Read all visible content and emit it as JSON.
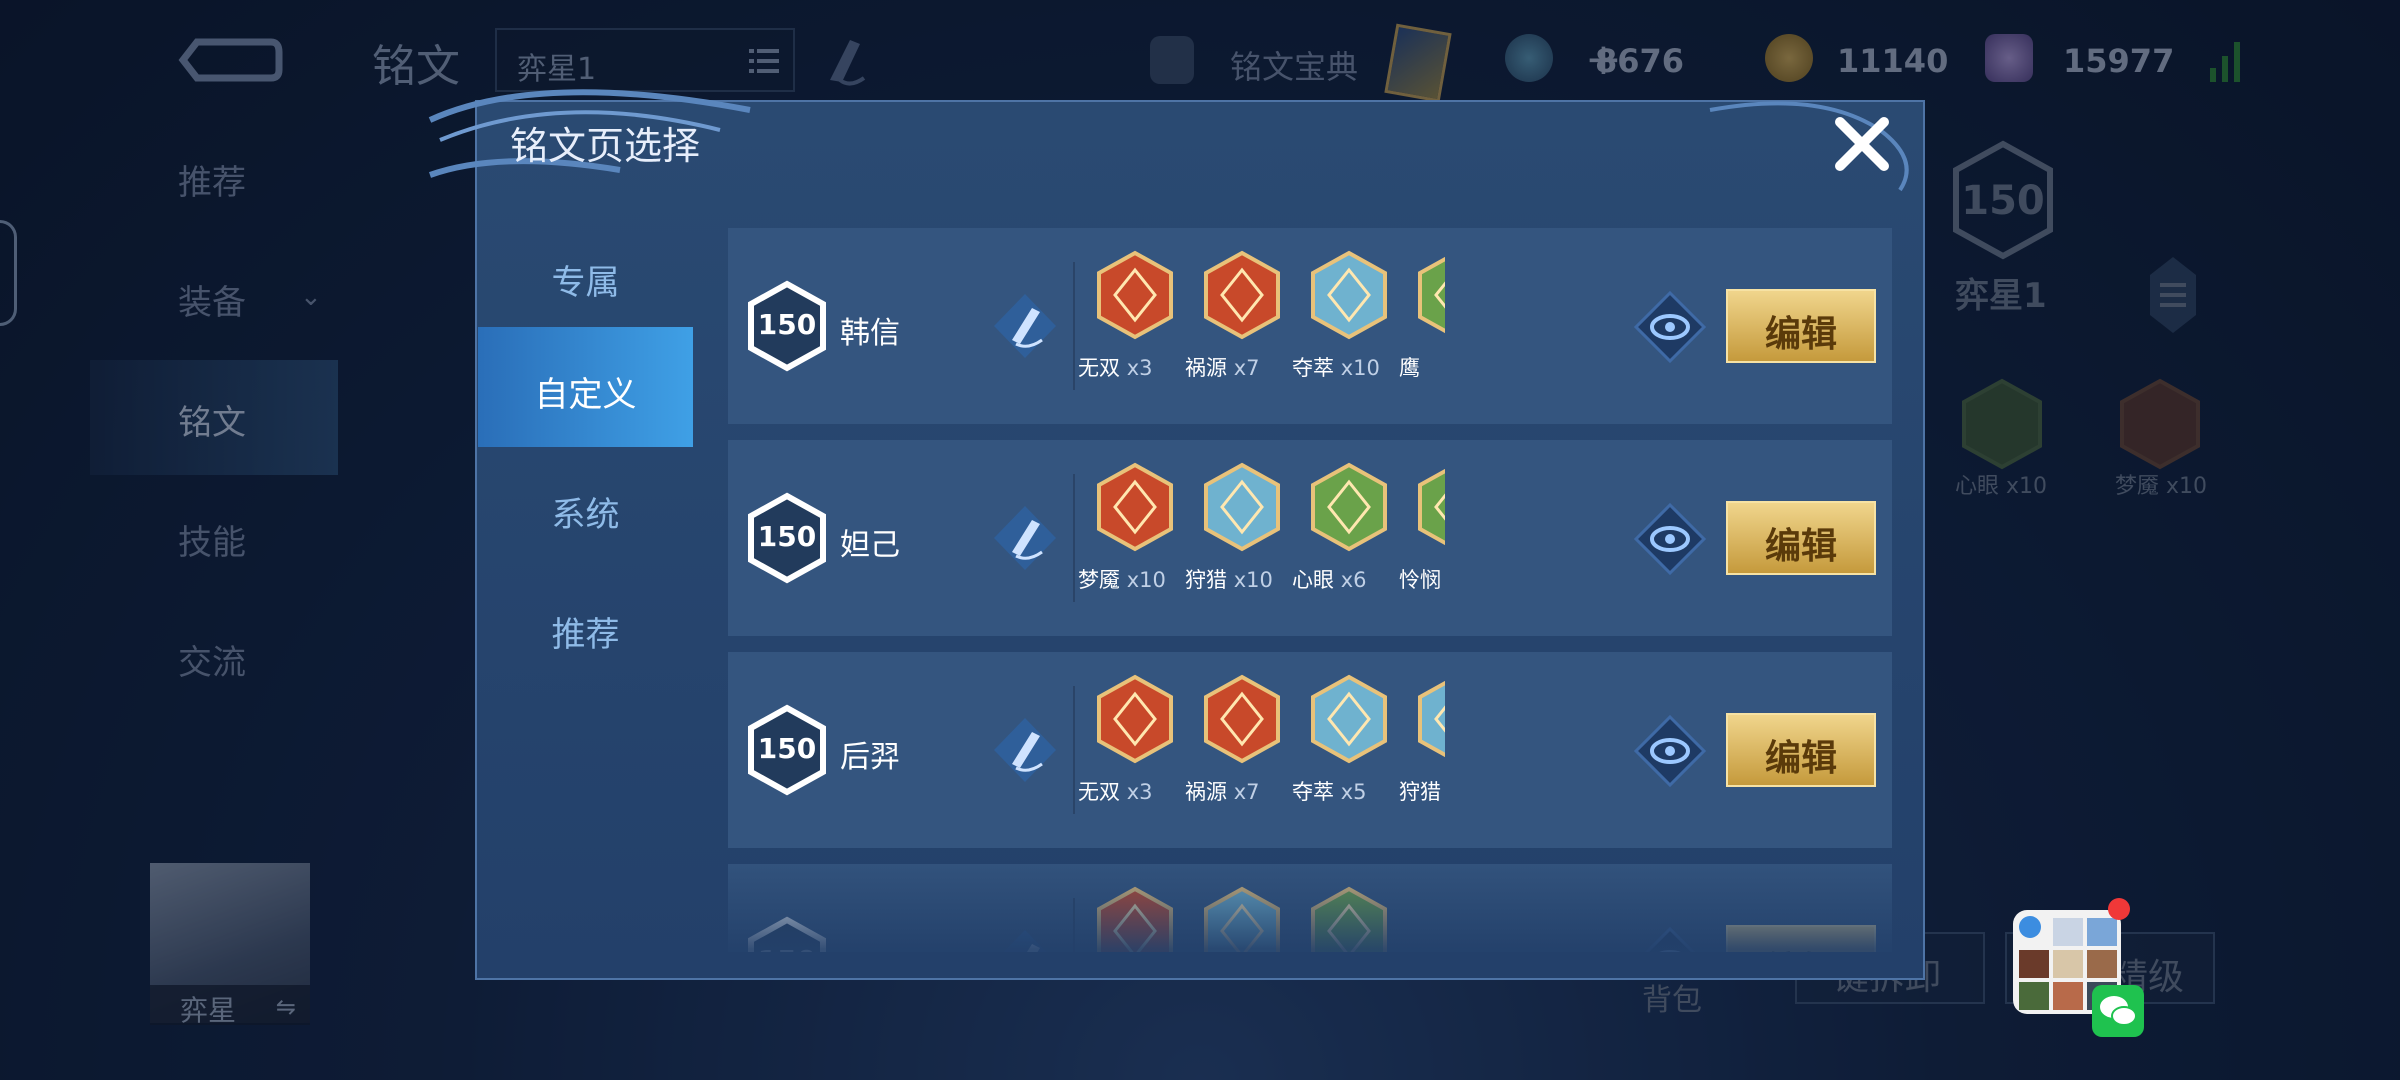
{
  "header": {
    "page_title": "铭文",
    "current_page": "弈星1",
    "codex_label": "铭文宝典",
    "currency_1": "8676",
    "currency_2": "11140",
    "currency_3": "15977"
  },
  "left_nav": {
    "items": [
      "推荐",
      "装备",
      "铭文",
      "技能",
      "交流"
    ],
    "active": "铭文"
  },
  "hero_avatar": {
    "name": "弈星"
  },
  "right_panel": {
    "level": "150",
    "page_name": "弈星1",
    "runes": [
      {
        "label": "心眼 x10"
      },
      {
        "label": "梦魇 x10"
      }
    ],
    "bag_label": "背包",
    "button_1": "一键拆卸",
    "button_2": "精级"
  },
  "modal": {
    "title": "铭文页选择",
    "tabs": [
      "专属",
      "自定义",
      "系统",
      "推荐"
    ],
    "active_tab": "自定义",
    "edit_label": "编辑",
    "rows": [
      {
        "level": "150",
        "hero": "韩信",
        "runes": [
          {
            "name": "无双",
            "count": "x3",
            "color": "#c8492a"
          },
          {
            "name": "祸源",
            "count": "x7",
            "color": "#c8492a"
          },
          {
            "name": "夺萃",
            "count": "x10",
            "color": "#6fb2cf"
          },
          {
            "name": "鹰",
            "count": "",
            "color": "#6aa24a"
          }
        ]
      },
      {
        "level": "150",
        "hero": "妲己",
        "runes": [
          {
            "name": "梦魇",
            "count": "x10",
            "color": "#c8492a"
          },
          {
            "name": "狩猎",
            "count": "x10",
            "color": "#6fb2cf"
          },
          {
            "name": "心眼",
            "count": "x6",
            "color": "#6aa24a"
          },
          {
            "name": "怜悯",
            "count": "",
            "color": "#6aa24a"
          }
        ]
      },
      {
        "level": "150",
        "hero": "后羿",
        "runes": [
          {
            "name": "无双",
            "count": "x3",
            "color": "#c8492a"
          },
          {
            "name": "祸源",
            "count": "x7",
            "color": "#c8492a"
          },
          {
            "name": "夺萃",
            "count": "x5",
            "color": "#6fb2cf"
          },
          {
            "name": "狩猎",
            "count": "",
            "color": "#6fb2cf"
          }
        ]
      },
      {
        "level": "150",
        "hero": "",
        "runes": [
          {
            "name": "",
            "count": "",
            "color": "#c8492a"
          },
          {
            "name": "",
            "count": "",
            "color": "#6fb2cf"
          },
          {
            "name": "",
            "count": "",
            "color": "#6aa24a"
          }
        ]
      }
    ]
  },
  "colors": {
    "accent_gold": "#e6c878",
    "tab_active": "#3a8fd8",
    "row_bg": "#34557f"
  },
  "icons": [
    "back-icon",
    "list-icon",
    "brush-icon",
    "codex-icon",
    "card-icon",
    "gem-icon",
    "coin-icon",
    "diamond-icon",
    "plus-icon",
    "signal-icon",
    "close-icon",
    "eye-icon",
    "menu-icon",
    "wechat-icon"
  ]
}
